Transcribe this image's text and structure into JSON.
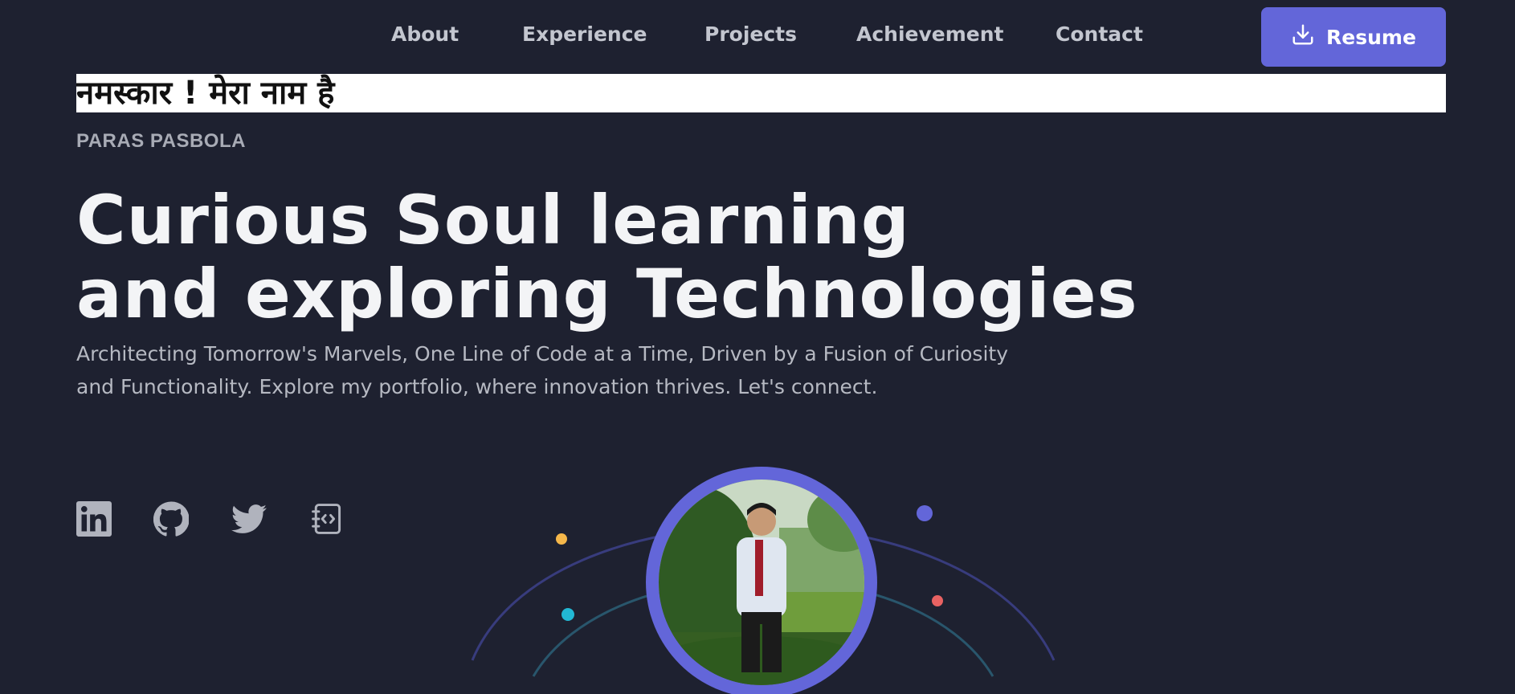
{
  "nav": {
    "links": [
      "About",
      "Experience",
      "Projects",
      "Achievement",
      "Contact"
    ],
    "resume_label": "Resume"
  },
  "hero": {
    "greeting": "नमस्कार ! मेरा नाम है",
    "name": "PARAS PASBOLA",
    "headline_line1": "Curious Soul learning",
    "headline_line2": "and exploring Technologies",
    "tagline": "Architecting Tomorrow's Marvels, One Line of Code at a Time, Driven by a Fusion of Curiosity and Functionality. Explore my portfolio, where innovation thrives. Let's connect."
  },
  "social_icons": [
    "linkedin-icon",
    "github-icon",
    "twitter-icon",
    "blog-notebook-icon"
  ],
  "colors": {
    "background": "#1e2130",
    "accent": "#6366d9",
    "dot_yellow": "#f5b74a",
    "dot_cyan": "#22b8d4",
    "dot_blue": "#6366d9",
    "dot_red": "#e86262"
  }
}
